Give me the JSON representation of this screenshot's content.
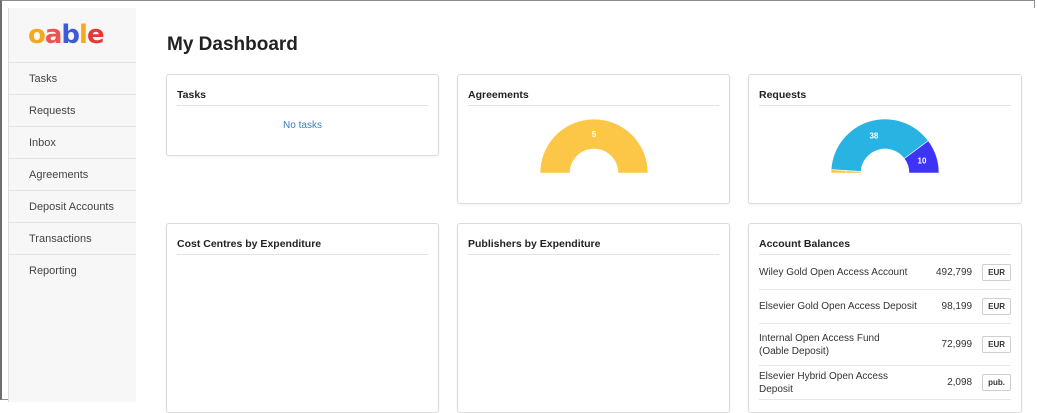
{
  "app": {
    "logo_text": "oable",
    "logo_colors": [
      "#f7a81b",
      "#ef5350",
      "#3b5bdb",
      "#f7a81b",
      "#e53935"
    ]
  },
  "sidebar": {
    "items": [
      {
        "label": "Tasks"
      },
      {
        "label": "Requests"
      },
      {
        "label": "Inbox"
      },
      {
        "label": "Agreements"
      },
      {
        "label": "Deposit Accounts"
      },
      {
        "label": "Transactions"
      },
      {
        "label": "Reporting"
      }
    ]
  },
  "main": {
    "title": "My Dashboard"
  },
  "tasks_card": {
    "title": "Tasks",
    "empty_text": "No tasks"
  },
  "agreements_card": {
    "title": "Agreements",
    "chart_data": {
      "type": "pie",
      "style": "half-donut",
      "slices": [
        {
          "label": "5",
          "value": 5,
          "color": "#fcc646"
        }
      ]
    }
  },
  "requests_card": {
    "title": "Requests",
    "chart_data": {
      "type": "pie",
      "style": "half-donut",
      "slices": [
        {
          "label": "1",
          "value": 1,
          "color": "#fcc646"
        },
        {
          "label": "38",
          "value": 38,
          "color": "#29b3e3"
        },
        {
          "label": "10",
          "value": 10,
          "color": "#3d34f5"
        }
      ]
    }
  },
  "cost_centres_card": {
    "title": "Cost Centres by Expenditure"
  },
  "publishers_card": {
    "title": "Publishers by Expenditure"
  },
  "balances_card": {
    "title": "Account Balances",
    "rows": [
      {
        "name": "Wiley Gold Open Access Account",
        "amount": "492,799",
        "currency": "EUR"
      },
      {
        "name": "Elsevier Gold Open Access Deposit",
        "amount": "98,199",
        "currency": "EUR"
      },
      {
        "name": "Internal Open Access Fund (Oable Deposit)",
        "amount": "72,999",
        "currency": "EUR"
      },
      {
        "name": "Elsevier Hybrid Open Access Deposit",
        "amount": "2,098",
        "currency": "pub."
      }
    ]
  }
}
